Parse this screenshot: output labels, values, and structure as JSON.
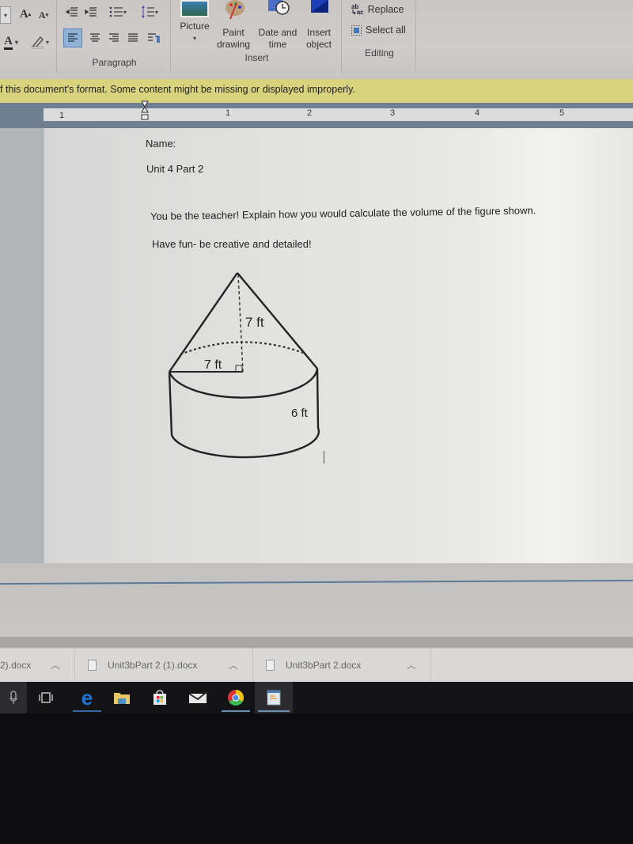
{
  "ribbon": {
    "font_group": {
      "grow_font": "A",
      "shrink_font": "A",
      "font_color": "A"
    },
    "paragraph_group": {
      "label": "Paragraph"
    },
    "insert_group": {
      "label": "Insert",
      "picture": "Picture",
      "paint_drawing_1": "Paint",
      "paint_drawing_2": "drawing",
      "date_time_1": "Date and",
      "date_time_2": "time",
      "insert_object_1": "Insert",
      "insert_object_2": "object"
    },
    "editing_group": {
      "label": "Editing",
      "replace": "Replace",
      "replace_icon_text": "ab",
      "select_all": "Select all"
    }
  },
  "infobar": {
    "message": "f this document's format. Some content might be missing or displayed improperly."
  },
  "ruler": {
    "labels": [
      "1",
      "1",
      "2",
      "3",
      "4",
      "5"
    ]
  },
  "document": {
    "line1": "Name:",
    "line2": "Unit 4 Part 2",
    "line3": "You be the teacher! Explain how you would calculate the volume of the figure shown.",
    "line4": "Have fun- be creative and detailed!",
    "figure": {
      "cone_height_label": "7 ft",
      "radius_label": "7 ft",
      "cylinder_height_label": "6 ft"
    }
  },
  "downloads": {
    "items": [
      {
        "name": "2).docx"
      },
      {
        "name": "Unit3bPart 2 (1).docx"
      },
      {
        "name": "Unit3bPart 2.docx"
      }
    ]
  },
  "taskbar": {
    "apps": [
      "microphone",
      "task-view",
      "edge",
      "file-explorer",
      "store",
      "mail",
      "chrome",
      "wordpad"
    ],
    "colors": {
      "edge": "#1e73d8",
      "underline": "#6b8fb0"
    }
  }
}
